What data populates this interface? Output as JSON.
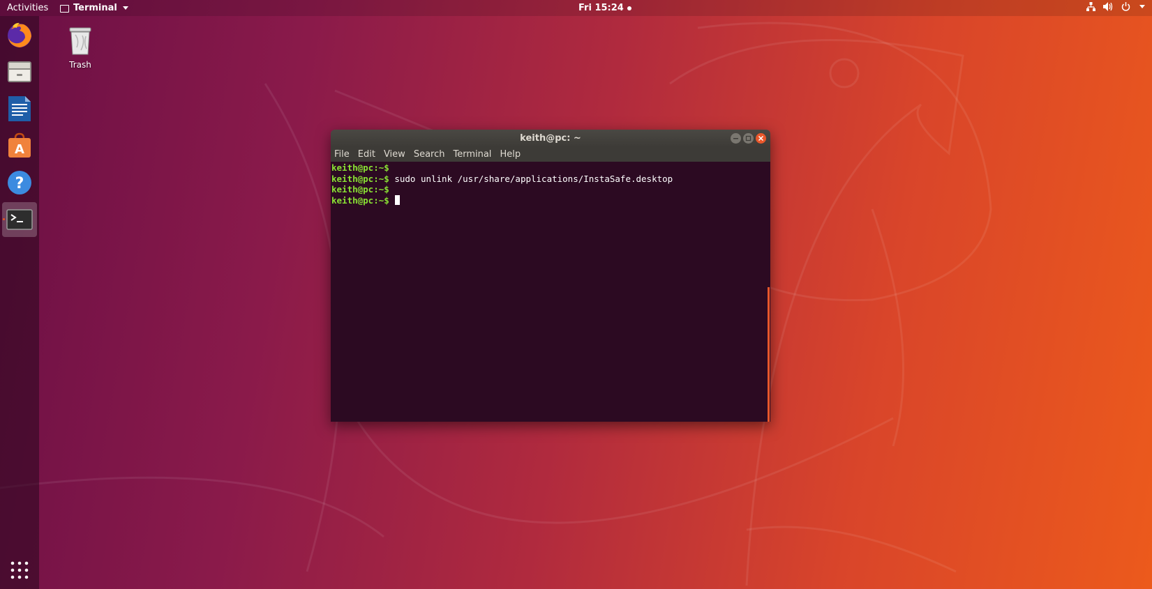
{
  "topbar": {
    "activities": "Activities",
    "app_name": "Terminal",
    "clock": "Fri 15:24"
  },
  "dock": {
    "items": [
      {
        "name": "Firefox",
        "icon": "firefox-icon"
      },
      {
        "name": "Files",
        "icon": "files-icon"
      },
      {
        "name": "LibreOffice Writer",
        "icon": "writer-icon"
      },
      {
        "name": "Ubuntu Software",
        "icon": "software-icon"
      },
      {
        "name": "Help",
        "icon": "help-icon"
      },
      {
        "name": "Terminal",
        "icon": "terminal-icon",
        "active": true
      }
    ],
    "show_apps_icon": "app-grid-icon"
  },
  "desktop": {
    "trash_label": "Trash"
  },
  "terminal": {
    "title": "keith@pc: ~",
    "menu": [
      "File",
      "Edit",
      "View",
      "Search",
      "Terminal",
      "Help"
    ],
    "lines": [
      {
        "prompt": "keith@pc:~$",
        "command": ""
      },
      {
        "prompt": "keith@pc:~$",
        "command": " sudo unlink /usr/share/applications/InstaSafe.desktop"
      },
      {
        "prompt": "keith@pc:~$",
        "command": ""
      },
      {
        "prompt": "keith@pc:~$",
        "command": " "
      }
    ]
  },
  "colors": {
    "accent": "#e95420",
    "prompt": "#8ae234",
    "terminal_bg": "#2c0a22"
  }
}
